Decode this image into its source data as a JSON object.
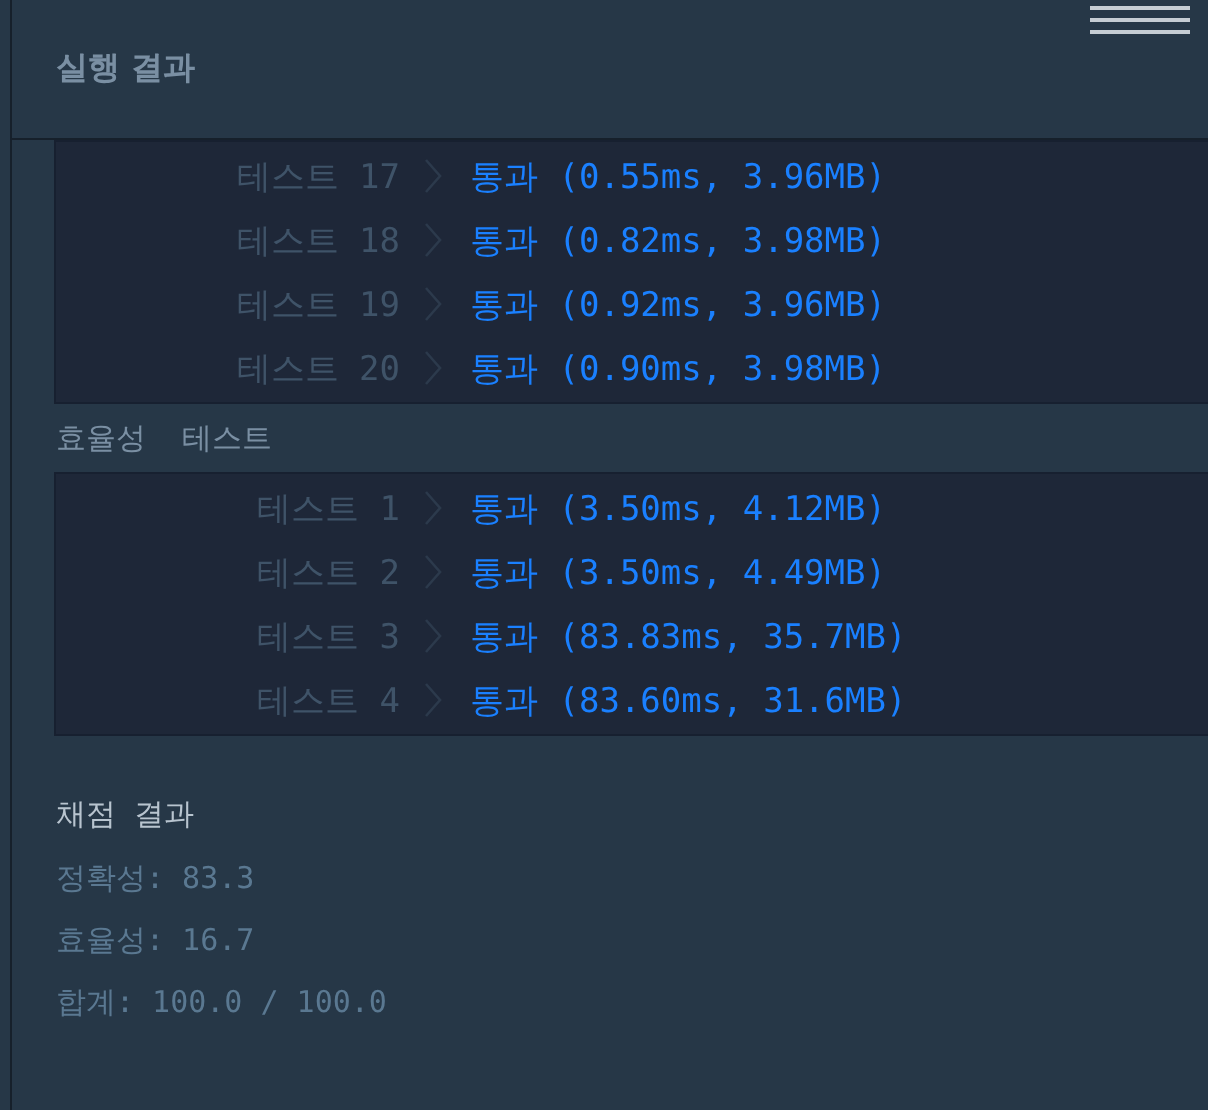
{
  "title": "실행 결과",
  "groups": [
    {
      "rows": [
        {
          "label": "테스트 17",
          "result": "통과",
          "detail": "(0.55ms, 3.96MB)"
        },
        {
          "label": "테스트 18",
          "result": "통과",
          "detail": "(0.82ms, 3.98MB)"
        },
        {
          "label": "테스트 19",
          "result": "통과",
          "detail": "(0.92ms, 3.96MB)"
        },
        {
          "label": "테스트 20",
          "result": "통과",
          "detail": "(0.90ms, 3.98MB)"
        }
      ]
    },
    {
      "heading": "효율성  테스트",
      "rows": [
        {
          "label": "테스트 1",
          "result": "통과",
          "detail": "(3.50ms, 4.12MB)"
        },
        {
          "label": "테스트 2",
          "result": "통과",
          "detail": "(3.50ms, 4.49MB)"
        },
        {
          "label": "테스트 3",
          "result": "통과",
          "detail": "(83.83ms, 35.7MB)"
        },
        {
          "label": "테스트 4",
          "result": "통과",
          "detail": "(83.60ms, 31.6MB)"
        }
      ]
    }
  ],
  "score": {
    "title": "채점 결과",
    "lines": [
      "정확성: 83.3",
      "효율성: 16.7",
      "합계: 100.0 / 100.0"
    ]
  }
}
